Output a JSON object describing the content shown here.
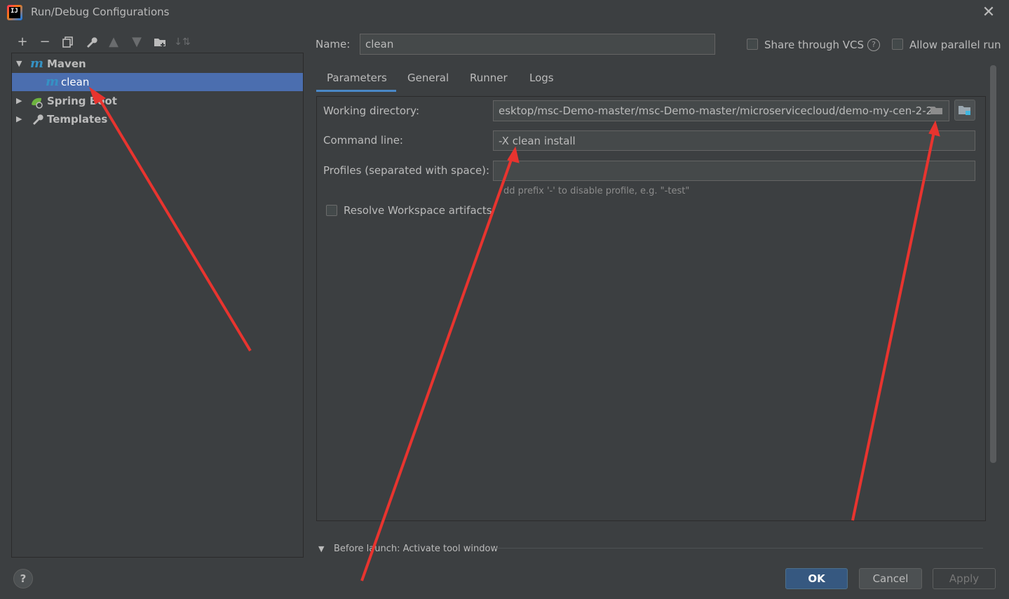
{
  "window": {
    "title": "Run/Debug Configurations"
  },
  "tree": {
    "maven": {
      "label": "Maven"
    },
    "clean": {
      "label": "clean"
    },
    "spring_boot": {
      "label": "Spring Boot"
    },
    "templates": {
      "label": "Templates"
    }
  },
  "form": {
    "name_label": "Name:",
    "name_value": "clean",
    "share_vcs": "Share through VCS",
    "allow_parallel": "Allow parallel run"
  },
  "tabs": [
    "Parameters",
    "General",
    "Runner",
    "Logs"
  ],
  "parameters": {
    "working_dir_label": "Working directory:",
    "working_dir_value": "esktop/msc-Demo-master/msc-Demo-master/microservicecloud/demo-my-cen-2-2",
    "command_line_label": "Command line:",
    "command_line_value": "-X clean install",
    "profiles_label": "Profiles (separated with space):",
    "profiles_value": "",
    "profiles_hint": "dd prefix '-' to disable profile, e.g. \"-test\"",
    "resolve_workspace": "Resolve Workspace artifacts"
  },
  "before_launch": "Before launch: Activate tool window",
  "buttons": {
    "ok": "OK",
    "cancel": "Cancel",
    "apply": "Apply",
    "help": "?"
  },
  "colors": {
    "accent": "#4b6eaf",
    "annotation": "#e8342f"
  }
}
